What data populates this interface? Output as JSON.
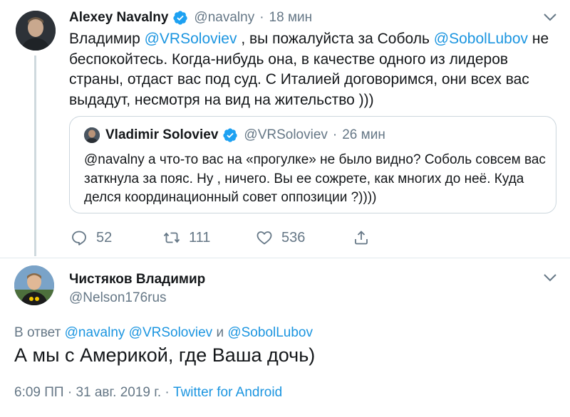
{
  "tweet": {
    "author_name": "Alexey Navalny",
    "author_handle": "@navalny",
    "separator": "·",
    "time": "18 мин",
    "text_parts": [
      "Владимир ",
      "@VRSoloviev",
      " , вы пожалуйста за Соболь ",
      "@SobolLubov",
      " не беспокойтесь. Когда-нибудь она, в качестве одного из лидеров страны, отдаст вас под суд. С Италией договоримся, они всех вас выдадут, несмотря на вид на жительство )))"
    ],
    "quote": {
      "author_name": "Vladimir Soloviev",
      "author_handle": "@VRSoloviev",
      "separator": "·",
      "time": "26 мин",
      "text": "@navalny а что-то вас на «прогулке» не было видно? Соболь совсем вас заткнула за пояс. Ну , ничего. Вы ее сожрете, как многих до неё. Куда делся координационный совет оппозиции ?))))"
    },
    "actions": {
      "replies": "52",
      "retweets": "111",
      "likes": "536"
    }
  },
  "reply": {
    "author_name": "Чистяков Владимир",
    "author_handle": "@Nelson176rus",
    "reply_to_prefix": "В ответ ",
    "reply_to_mentions": "@navalny @VRSoloviev",
    "reply_to_and": " и ",
    "reply_to_last": "@SobolLubov",
    "text": "А мы с Америкой, где Ваша дочь)",
    "timestamp": "6:09 ПП · 31 авг. 2019 г. · ",
    "client": "Twitter for Android"
  },
  "colors": {
    "link": "#1b95e0",
    "secondary_text": "#657786",
    "border": "#ccd6dd",
    "verified": "#1da1f2"
  },
  "icons": [
    "verified-badge-icon",
    "chevron-down-icon",
    "reply-icon",
    "retweet-icon",
    "like-icon",
    "share-icon"
  ]
}
